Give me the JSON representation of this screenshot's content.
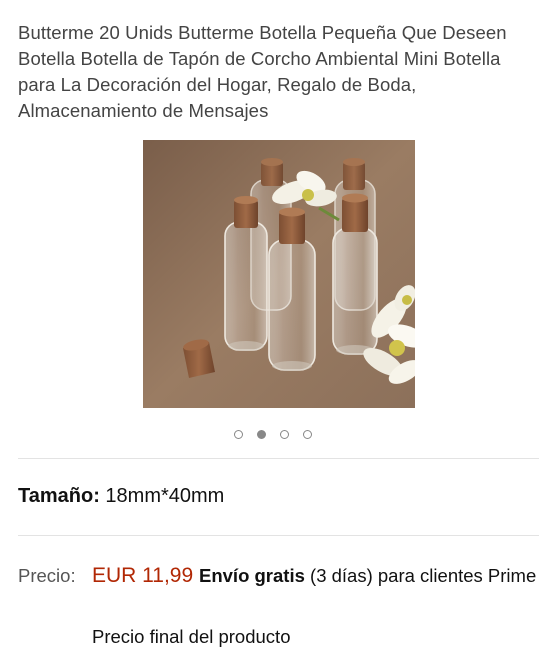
{
  "product": {
    "title": "Butterme 20 Unids Butterme Botella Pequeña Que Deseen Botella Botella de Tapón de Corcho Ambiental Mini Botella para La Decoración del Hogar, Regalo de Boda, Almacenamiento de Mensajes"
  },
  "gallery": {
    "image_count": 4,
    "active_index": 1
  },
  "size": {
    "label": "Tamaño:",
    "value": "18mm*40mm"
  },
  "price": {
    "label": "Precio:",
    "amount": "EUR 11,99",
    "shipping_bold": "Envío gratis",
    "shipping_rest": "(3 días) para clientes Prime",
    "final_note": "Precio final del producto"
  },
  "colors": {
    "price": "#b12704",
    "divider": "#e3e3e3"
  }
}
